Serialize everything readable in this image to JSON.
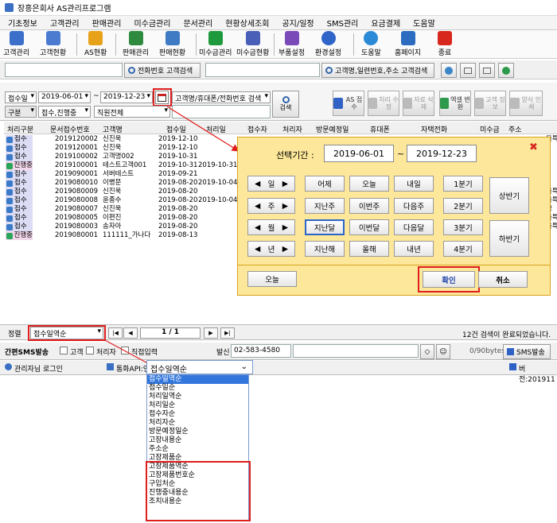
{
  "app": {
    "title": "장흥은회사 AS관리프로그램"
  },
  "menu": [
    "기초정보",
    "고객관리",
    "판매관리",
    "미수금관리",
    "문서관리",
    "현황상세조회",
    "공지/일정",
    "SMS관리",
    "요금결제",
    "도움말"
  ],
  "toolbar": [
    {
      "label": "고객관리",
      "icon": "customer-mgmt-icon",
      "color": "#3b6fc9"
    },
    {
      "label": "고객현황",
      "icon": "customer-status-icon",
      "color": "#4a7bd0"
    },
    {
      "label": "AS현황",
      "icon": "as-status-icon",
      "color": "#e8a21a"
    },
    {
      "label": "판매관리",
      "icon": "sales-mgmt-icon",
      "color": "#2d8a3e"
    },
    {
      "label": "판매현황",
      "icon": "sales-status-icon",
      "color": "#3f7ac4"
    },
    {
      "label": "미수금관리",
      "icon": "dollar-icon",
      "color": "#1e9a3c"
    },
    {
      "label": "미수금현황",
      "icon": "receivable-status-icon",
      "color": "#4a5fb8"
    },
    {
      "label": "부품설정",
      "icon": "parts-icon",
      "color": "#7a4ab8"
    },
    {
      "label": "환경설정",
      "icon": "gear-icon",
      "color": "#2f64c9"
    },
    {
      "label": "도움말",
      "icon": "help-icon",
      "color": "#2a8ad8"
    },
    {
      "label": "홈페이지",
      "icon": "home-icon",
      "color": "#2b6cc0"
    },
    {
      "label": "종료",
      "icon": "power-icon",
      "color": "#d8281e"
    }
  ],
  "quick": {
    "phone_search_btn": "전화번호 고객검색",
    "name_search_btn": "고객명,일련번호,주소 고객검색"
  },
  "filter": {
    "date_type": "접수일",
    "date_from": "2019-06-01",
    "date_sep": "~",
    "date_to": "2019-12-23",
    "search_type": "고객명/휴대폰/전화번호 검색",
    "search_btn": "검색",
    "category": "구분",
    "status": "접수,진행중",
    "staff": "직원전체",
    "action_btns": [
      {
        "label": "AS 접수",
        "icon": "as-receive-icon",
        "color": "#2f62c4",
        "disabled": false
      },
      {
        "label": "처리 수정",
        "icon": "edit-process-icon",
        "color": "#bbb",
        "disabled": true
      },
      {
        "label": "자료 삭제",
        "icon": "delete-icon",
        "color": "#bbb",
        "disabled": true
      },
      {
        "label": "엑셀 변환",
        "icon": "excel-icon",
        "color": "#2c9a4a",
        "disabled": false
      },
      {
        "label": "고객 정보",
        "icon": "customer-info-icon",
        "color": "#bbb",
        "disabled": true
      },
      {
        "label": "양식 인쇄",
        "icon": "print-icon",
        "color": "#bbb",
        "disabled": true
      }
    ]
  },
  "grid": {
    "columns": [
      "처리구분",
      "문서접수번호",
      "고객명",
      "접수일",
      "처리일",
      "접수자",
      "처리자",
      "방문예정일",
      "휴대폰",
      "자택전화",
      "미수금",
      "주소"
    ],
    "rows": [
      {
        "status": "접수",
        "no": "2019120002",
        "name": "신진욱",
        "recv": "2019-12-10",
        "proc": ""
      },
      {
        "status": "접수",
        "no": "2019120001",
        "name": "신진욱",
        "recv": "2019-12-10",
        "proc": ""
      },
      {
        "status": "접수",
        "no": "2019100002",
        "name": "고객명002",
        "recv": "2019-10-31",
        "proc": ""
      },
      {
        "status": "진행중",
        "no": "2019100001",
        "name": "테스트고객001",
        "recv": "2019-10-31",
        "proc": "2019-10-31"
      },
      {
        "status": "접수",
        "no": "2019090001",
        "name": "서버테스트",
        "recv": "2019-09-21",
        "proc": ""
      },
      {
        "status": "접수",
        "no": "2019080010",
        "name": "이병문",
        "recv": "2019-08-20",
        "proc": "2019-10-04"
      },
      {
        "status": "접수",
        "no": "2019080009",
        "name": "신진욱",
        "recv": "2019-08-20",
        "proc": ""
      },
      {
        "status": "접수",
        "no": "2019080008",
        "name": "윤종수",
        "recv": "2019-08-20",
        "proc": "2019-10-04"
      },
      {
        "status": "접수",
        "no": "2019080007",
        "name": "신진욱",
        "recv": "2019-08-20",
        "proc": ""
      },
      {
        "status": "접수",
        "no": "2019080005",
        "name": "이편진",
        "recv": "2019-08-20",
        "proc": ""
      },
      {
        "status": "접수",
        "no": "2019080003",
        "name": "송자아",
        "recv": "2019-08-20",
        "proc": ""
      },
      {
        "status": "진행중",
        "no": "2019080001",
        "name": "111111_가나다",
        "recv": "2019-08-13",
        "proc": ""
      }
    ],
    "right_edge": [
      "울특",
      "",
      "",
      "",
      "",
      "",
      "울특",
      "울특",
      "낙",
      "울특",
      "울특",
      ""
    ]
  },
  "nav": {
    "sort_label": "정렬",
    "sort_value": "접수일역순",
    "page": "1 / 1",
    "result": "12건 검색이 완료되었습니다."
  },
  "sms": {
    "title": "간편SMS발송",
    "opt1": "고객",
    "opt2": "처리자",
    "opt3": "직접입력",
    "sender_label": "발신",
    "sender": "02-583-4580",
    "bytes": "0/90bytes",
    "send_btn": "SMS발송"
  },
  "status": {
    "login": "관리자님 로그인",
    "call_api": "통화API:연",
    "version": "버전:201911"
  },
  "popup": {
    "title": "선택기간 :",
    "from": "2019-06-01",
    "sep": "~",
    "to": "2019-12-23",
    "unit_day": "일",
    "unit_week": "주",
    "unit_month": "월",
    "unit_year": "년",
    "yesterday": "어제",
    "today": "오늘",
    "tomorrow": "내일",
    "last_week": "지난주",
    "this_week": "이번주",
    "next_week": "다음주",
    "last_month": "지난달",
    "this_month": "이번달",
    "next_month": "다음달",
    "last_year": "지난해",
    "this_year": "올해",
    "next_year": "내년",
    "q1": "1분기",
    "q2": "2분기",
    "q3": "3분기",
    "q4": "4분기",
    "h1": "상반기",
    "h2": "하반기",
    "today_btn": "오늘",
    "ok": "확인",
    "cancel": "취소"
  },
  "dropdown": {
    "current": "접수일역순",
    "options": [
      "접수일역순",
      "접수일순",
      "처리일역순",
      "처리일순",
      "접수자순",
      "처리자순",
      "방문예정일순",
      "고장내용순",
      "주소순",
      "고장제품순",
      "고장제품역순",
      "고장제품번호순",
      "구입처순",
      "진행중내용순",
      "조치내용순"
    ]
  },
  "colors": {
    "accent": "#e01e1e",
    "popup_bg": "#fde79a",
    "selection": "#3377dd"
  }
}
